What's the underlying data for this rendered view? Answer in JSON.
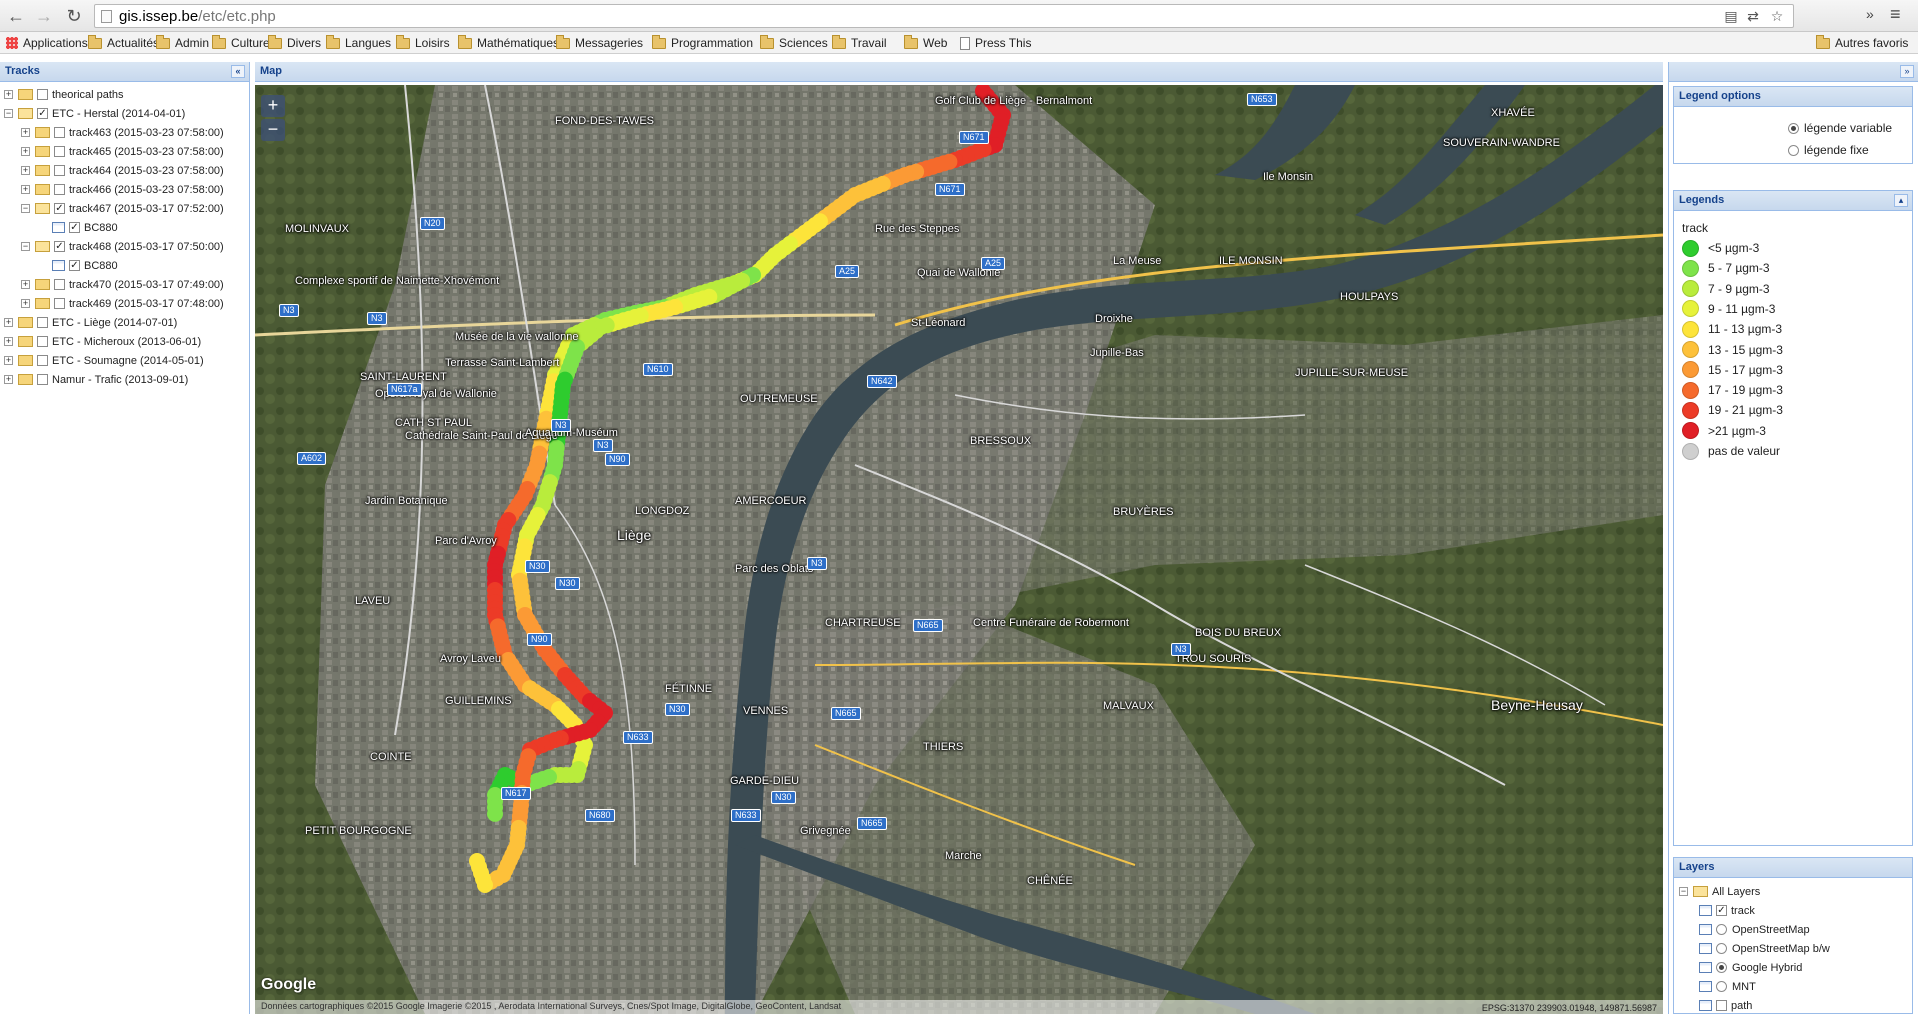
{
  "browser": {
    "url_host": "gis.issep.be",
    "url_path": "/etc/etc.php",
    "bookmarks": [
      {
        "label": "Applications",
        "icon": "apps-icon"
      },
      {
        "label": "Actualités",
        "icon": "folder-icon"
      },
      {
        "label": "Admin",
        "icon": "folder-icon"
      },
      {
        "label": "Culture",
        "icon": "folder-icon"
      },
      {
        "label": "Divers",
        "icon": "folder-icon"
      },
      {
        "label": "Langues",
        "icon": "folder-icon"
      },
      {
        "label": "Loisirs",
        "icon": "folder-icon"
      },
      {
        "label": "Mathématiques",
        "icon": "folder-icon"
      },
      {
        "label": "Messageries",
        "icon": "folder-icon"
      },
      {
        "label": "Programmation",
        "icon": "folder-icon"
      },
      {
        "label": "Sciences",
        "icon": "folder-icon"
      },
      {
        "label": "Travail",
        "icon": "folder-icon"
      },
      {
        "label": "Web",
        "icon": "folder-icon"
      },
      {
        "label": "Press This",
        "icon": "page-icon"
      }
    ],
    "other_bookmarks": "Autres favoris"
  },
  "tracks": {
    "title": "Tracks",
    "items": [
      {
        "label": "theorical paths",
        "level": 0,
        "expander": "+",
        "checked": false,
        "open": false
      },
      {
        "label": "ETC - Herstal (2014-04-01)",
        "level": 0,
        "expander": "-",
        "checked": true,
        "open": true
      },
      {
        "label": "track463 (2015-03-23 07:58:00)",
        "level": 1,
        "expander": "+",
        "checked": false,
        "open": false
      },
      {
        "label": "track465 (2015-03-23 07:58:00)",
        "level": 1,
        "expander": "+",
        "checked": false,
        "open": false
      },
      {
        "label": "track464 (2015-03-23 07:58:00)",
        "level": 1,
        "expander": "+",
        "checked": false,
        "open": false
      },
      {
        "label": "track466 (2015-03-23 07:58:00)",
        "level": 1,
        "expander": "+",
        "checked": false,
        "open": false
      },
      {
        "label": "track467 (2015-03-17 07:52:00)",
        "level": 1,
        "expander": "-",
        "checked": true,
        "open": true
      },
      {
        "label": "BC880",
        "level": 2,
        "leaf": true,
        "checked": true
      },
      {
        "label": "track468 (2015-03-17 07:50:00)",
        "level": 1,
        "expander": "-",
        "checked": true,
        "open": true
      },
      {
        "label": "BC880",
        "level": 2,
        "leaf": true,
        "checked": true
      },
      {
        "label": "track470 (2015-03-17 07:49:00)",
        "level": 1,
        "expander": "+",
        "checked": false,
        "open": false
      },
      {
        "label": "track469 (2015-03-17 07:48:00)",
        "level": 1,
        "expander": "+",
        "checked": false,
        "open": false
      },
      {
        "label": "ETC - Liège (2014-07-01)",
        "level": 0,
        "expander": "+",
        "checked": false,
        "open": false
      },
      {
        "label": "ETC - Micheroux (2013-06-01)",
        "level": 0,
        "expander": "+",
        "checked": false,
        "open": false
      },
      {
        "label": "ETC - Soumagne (2014-05-01)",
        "level": 0,
        "expander": "+",
        "checked": false,
        "open": false
      },
      {
        "label": "Namur - Trafic (2013-09-01)",
        "level": 0,
        "expander": "+",
        "checked": false,
        "open": false
      }
    ]
  },
  "map": {
    "title": "Map",
    "zoom_in": "+",
    "zoom_out": "−",
    "attribution": "Données cartographiques ©2015 Google Imagerie ©2015 , Aerodata International Surveys, Cnes/Spot Image, DigitalGlobe, GeoContent, Landsat",
    "coords": "EPSG:31370 239903.01948, 149871.56987",
    "google_logo": "Google",
    "labels": [
      {
        "text": "FOND-DES-TAWES"
      },
      {
        "text": "MOLINVAUX"
      },
      {
        "text": "Golf Club de Liège - Bernalmont"
      },
      {
        "text": "Rue des Steppes"
      },
      {
        "text": "Quai de Wallonie"
      },
      {
        "text": "La Meuse"
      },
      {
        "text": "ILE MONSIN"
      },
      {
        "text": "Ile Monsin"
      },
      {
        "text": "XHAVÉE"
      },
      {
        "text": "SOUVERAIN-WANDRE"
      },
      {
        "text": "Droixhe"
      },
      {
        "text": "Jupille-Bas"
      },
      {
        "text": "JUPILLE-SUR-MEUSE"
      },
      {
        "text": "HOULPAYS"
      },
      {
        "text": "Musée de la vie wallonne"
      },
      {
        "text": "Terrasse Saint-Lambert"
      },
      {
        "text": "SAINT-LAURENT"
      },
      {
        "text": "Opéra Royal de Wallonie"
      },
      {
        "text": "CATH ST PAUL"
      },
      {
        "text": "OUTREMEUSE"
      },
      {
        "text": "Cathédrale Saint-Paul de Liège"
      },
      {
        "text": "Aquarium-Muséum"
      },
      {
        "text": "BRESSOUX"
      },
      {
        "text": "LONGDOZ"
      },
      {
        "text": "AMERCOEUR"
      },
      {
        "text": "Jardin Botanique"
      },
      {
        "text": "Parc d'Avroy"
      },
      {
        "text": "Liège"
      },
      {
        "text": "Parc des Oblats"
      },
      {
        "text": "Centre Funéraire de Robermont"
      },
      {
        "text": "BRUYÈRES"
      },
      {
        "text": "LAVEU"
      },
      {
        "text": "CHARTREUSE"
      },
      {
        "text": "BOIS DU BREUX"
      },
      {
        "text": "TROU SOURIS"
      },
      {
        "text": "FÉTINNE"
      },
      {
        "text": "GUILLEMINS"
      },
      {
        "text": "VENNES"
      },
      {
        "text": "MALVAUX"
      },
      {
        "text": "THIERS"
      },
      {
        "text": "Beyne-Heusay"
      },
      {
        "text": "COINTE"
      },
      {
        "text": "GARDE-DIEU"
      },
      {
        "text": "PETIT BOURGOGNE"
      },
      {
        "text": "CHÊNÉE"
      },
      {
        "text": "Complexe sportif de Naimette-Xhovémont"
      },
      {
        "text": "St-Léonard"
      },
      {
        "text": "Avroy Laveu"
      },
      {
        "text": "Grivegnée"
      },
      {
        "text": "Marche"
      }
    ],
    "shields": [
      "N20",
      "N3",
      "N3",
      "N610",
      "N642",
      "N617a",
      "N3",
      "N3",
      "N90",
      "N30",
      "N30",
      "N90",
      "N3",
      "N665",
      "N3",
      "N665",
      "N30",
      "N633",
      "N617",
      "N680",
      "N633",
      "N30",
      "N665",
      "N671",
      "N671",
      "N653",
      "A25",
      "A25",
      "A602"
    ]
  },
  "legend_options": {
    "title": "Legend options",
    "options": [
      {
        "label": "légende variable",
        "selected": true
      },
      {
        "label": "légende fixe",
        "selected": false
      }
    ]
  },
  "legends": {
    "title": "Legends",
    "layer": "track",
    "items": [
      {
        "label": "<5 µgm-3",
        "color": "#2ecc2e"
      },
      {
        "label": "5 - 7 µgm-3",
        "color": "#7ee34a"
      },
      {
        "label": "7 - 9 µgm-3",
        "color": "#b9ec3c"
      },
      {
        "label": "9 - 11 µgm-3",
        "color": "#e6f23a"
      },
      {
        "label": "11 - 13 µgm-3",
        "color": "#fde43a"
      },
      {
        "label": "13 - 15 µgm-3",
        "color": "#fdc13a"
      },
      {
        "label": "15 - 17 µgm-3",
        "color": "#fb9a35"
      },
      {
        "label": "17 - 19 µgm-3",
        "color": "#f56a2c"
      },
      {
        "label": "19 - 21 µgm-3",
        "color": "#ec3b27"
      },
      {
        "label": ">21 µgm-3",
        "color": "#e01f26"
      },
      {
        "label": "pas de valeur",
        "color": "#cfcfcf"
      }
    ]
  },
  "layers": {
    "title": "Layers",
    "root": "All Layers",
    "items": [
      {
        "label": "track",
        "control": "checkbox",
        "checked": true
      },
      {
        "label": "OpenStreetMap",
        "control": "radio",
        "checked": false
      },
      {
        "label": "OpenStreetMap b/w",
        "control": "radio",
        "checked": false
      },
      {
        "label": "Google Hybrid",
        "control": "radio",
        "checked": true
      },
      {
        "label": "MNT",
        "control": "radio",
        "checked": false
      },
      {
        "label": "path",
        "control": "checkbox",
        "checked": false
      }
    ]
  }
}
